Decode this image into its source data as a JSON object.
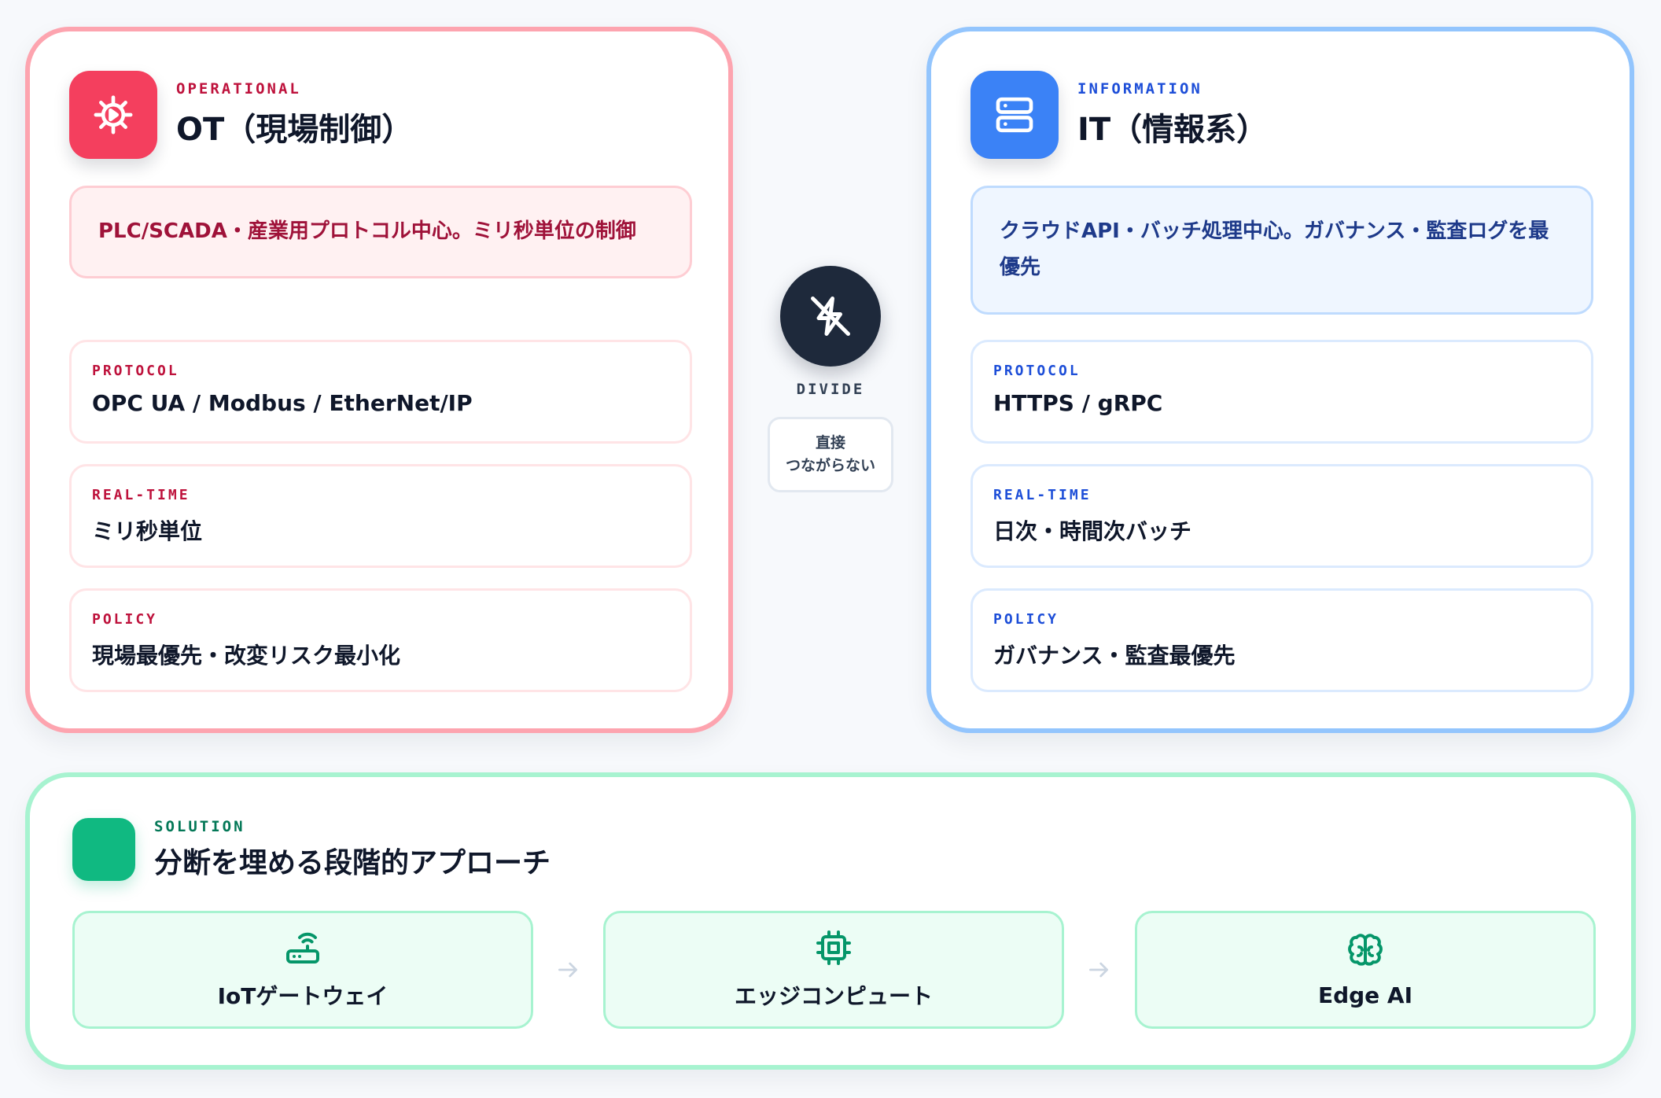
{
  "colors": {
    "ot_accent": "#f43f5e",
    "it_accent": "#3b82f6",
    "solution_accent": "#10b981",
    "divide_dark": "#1e293b"
  },
  "ot": {
    "icon": "gear-icon",
    "eyebrow": "OPERATIONAL",
    "title": "OT（現場制御）",
    "description": "PLC/SCADA・産業用プロトコル中心。ミリ秒単位の制御",
    "cards": [
      {
        "label": "PROTOCOL",
        "value": "OPC UA / Modbus / EtherNet/IP"
      },
      {
        "label": "REAL-TIME",
        "value": "ミリ秒単位"
      },
      {
        "label": "POLICY",
        "value": "現場最優先・改変リスク最小化"
      }
    ]
  },
  "it": {
    "icon": "server-icon",
    "eyebrow": "INFORMATION",
    "title": "IT（情報系）",
    "description": "クラウドAPI・バッチ処理中心。ガバナンス・監査ログを最優先",
    "cards": [
      {
        "label": "PROTOCOL",
        "value": "HTTPS / gRPC"
      },
      {
        "label": "REAL-TIME",
        "value": "日次・時間次バッチ"
      },
      {
        "label": "POLICY",
        "value": "ガバナンス・監査最優先"
      }
    ]
  },
  "divide": {
    "icon": "unplug-icon",
    "label": "DIVIDE",
    "note_line1": "直接",
    "note_line2": "つながらない"
  },
  "solution": {
    "eyebrow": "SOLUTION",
    "title": "分断を埋める段階的アプローチ",
    "steps": [
      {
        "icon": "router-icon",
        "label": "IoTゲートウェイ"
      },
      {
        "icon": "cpu-chip-icon",
        "label": "エッジコンピュート"
      },
      {
        "icon": "brain-icon",
        "label": "Edge AI"
      }
    ]
  }
}
